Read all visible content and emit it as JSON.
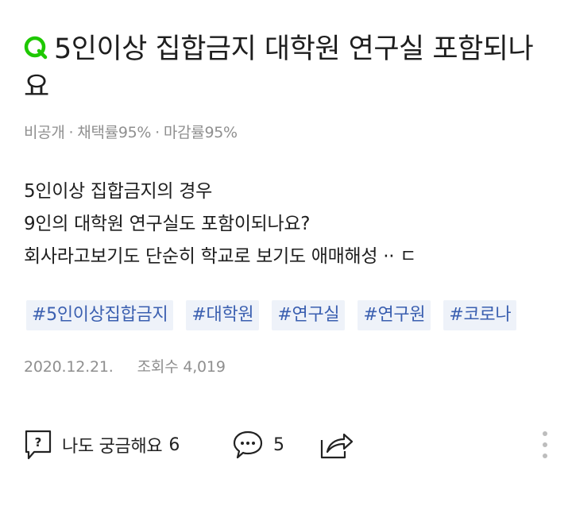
{
  "question": {
    "title": "5인이상 집합금지 대학원 연구실 포함되나요",
    "mark_icon": "q-icon",
    "accent_color": "#1ec800"
  },
  "meta": {
    "visibility": "비공개",
    "separator": "·",
    "adoption_rate": "채택률95%",
    "deadline_rate": "마감률95%"
  },
  "body": {
    "lines": [
      "5인이상 집합금지의 경우",
      "9인의 대학원 연구실도 포함이되나요?",
      "회사라고보기도 단순히 학교로 보기도 애매해성 ·· ㄷ"
    ]
  },
  "tags": [
    "#5인이상집합금지",
    "#대학원",
    "#연구실",
    "#연구원",
    "#코로나"
  ],
  "info": {
    "date": "2020.12.21.",
    "views": "조회수 4,019"
  },
  "actions": {
    "curious_label": "나도 궁금해요",
    "curious_count": "6",
    "comment_count": "5",
    "curious_icon": "question-bubble-icon",
    "comment_icon": "comment-icon",
    "share_icon": "share-icon",
    "more_icon": "more-vertical-icon"
  }
}
